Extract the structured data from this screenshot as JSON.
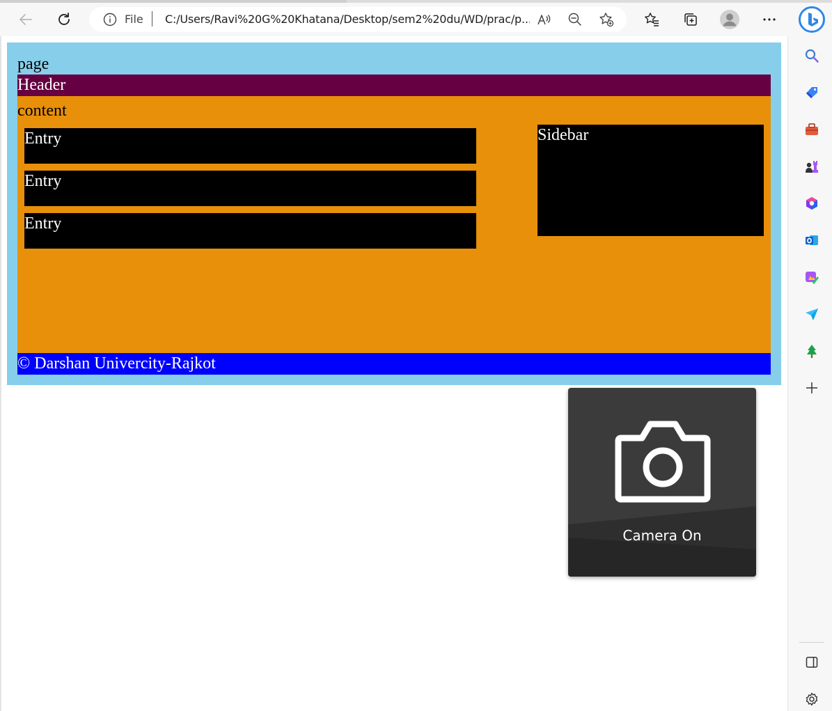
{
  "browser": {
    "address_scheme": "File",
    "address_url": "C:/Users/Ravi%20G%20Khatana/Desktop/sem2%20du/WD/prac/p...",
    "icons": [
      "back-arrow-icon",
      "refresh-icon",
      "info-icon",
      "read-aloud-icon",
      "zoom-out-icon",
      "add-favorite-icon",
      "favorites-icon",
      "collections-icon",
      "profile-avatar-icon",
      "more-menu-icon",
      "bing-icon"
    ]
  },
  "sidebar_apps": [
    "search-icon",
    "shopping-tag-icon",
    "tools-icon",
    "games-icon",
    "microsoft-365-icon",
    "outlook-icon",
    "designer-icon",
    "send-icon",
    "tree-icon",
    "add-icon",
    "hide-sidebar-icon",
    "settings-icon"
  ],
  "page": {
    "label": "page",
    "header": "Header",
    "content_label": "content",
    "entries": [
      "Entry",
      "Entry",
      "Entry"
    ],
    "sidebar": "Sidebar",
    "footer": "© Darshan Univercity-Rajkot",
    "colors": {
      "page_bg": "#87ceeb",
      "header_bg": "#660042",
      "content_bg": "#e8900a",
      "entry_bg": "#000000",
      "footer_bg": "#0000ff"
    }
  },
  "camera_overlay": {
    "label": "Camera On",
    "icon": "camera-icon"
  }
}
